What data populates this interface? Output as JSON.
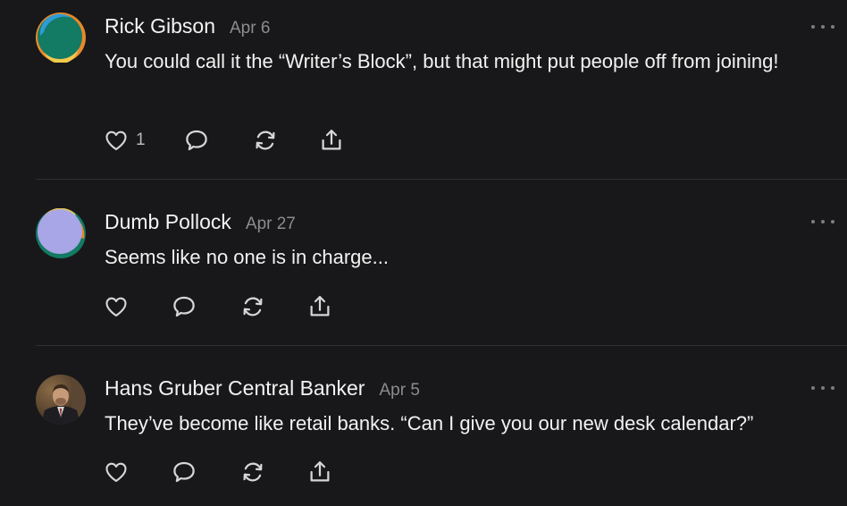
{
  "comments": [
    {
      "author": "Rick Gibson",
      "date": "Apr 6",
      "text": "You could call it the “Writer’s Block”, but that might put people off from joining!",
      "like_count": "1",
      "avatar_icon": "avatar-swirl-green"
    },
    {
      "author": "Dumb Pollock",
      "date": "Apr 27",
      "text": "Seems like no one is in charge...",
      "like_count": "",
      "avatar_icon": "avatar-swirl-lavender"
    },
    {
      "author": "Hans Gruber Central Banker",
      "date": "Apr 5",
      "text": "They’ve become like retail banks. “Can I give you our new desk calendar?”",
      "like_count": "",
      "avatar_icon": "avatar-photo"
    }
  ],
  "icons": {
    "like": "heart-icon",
    "reply": "comment-icon",
    "restack": "restack-icon",
    "share": "share-icon",
    "more": "more-options-icon"
  },
  "colors": {
    "background": "#18181a",
    "text": "#f2f2f2",
    "muted": "#8c8c8f",
    "icon": "#d6d6d8",
    "divider": "#2f2f32"
  }
}
